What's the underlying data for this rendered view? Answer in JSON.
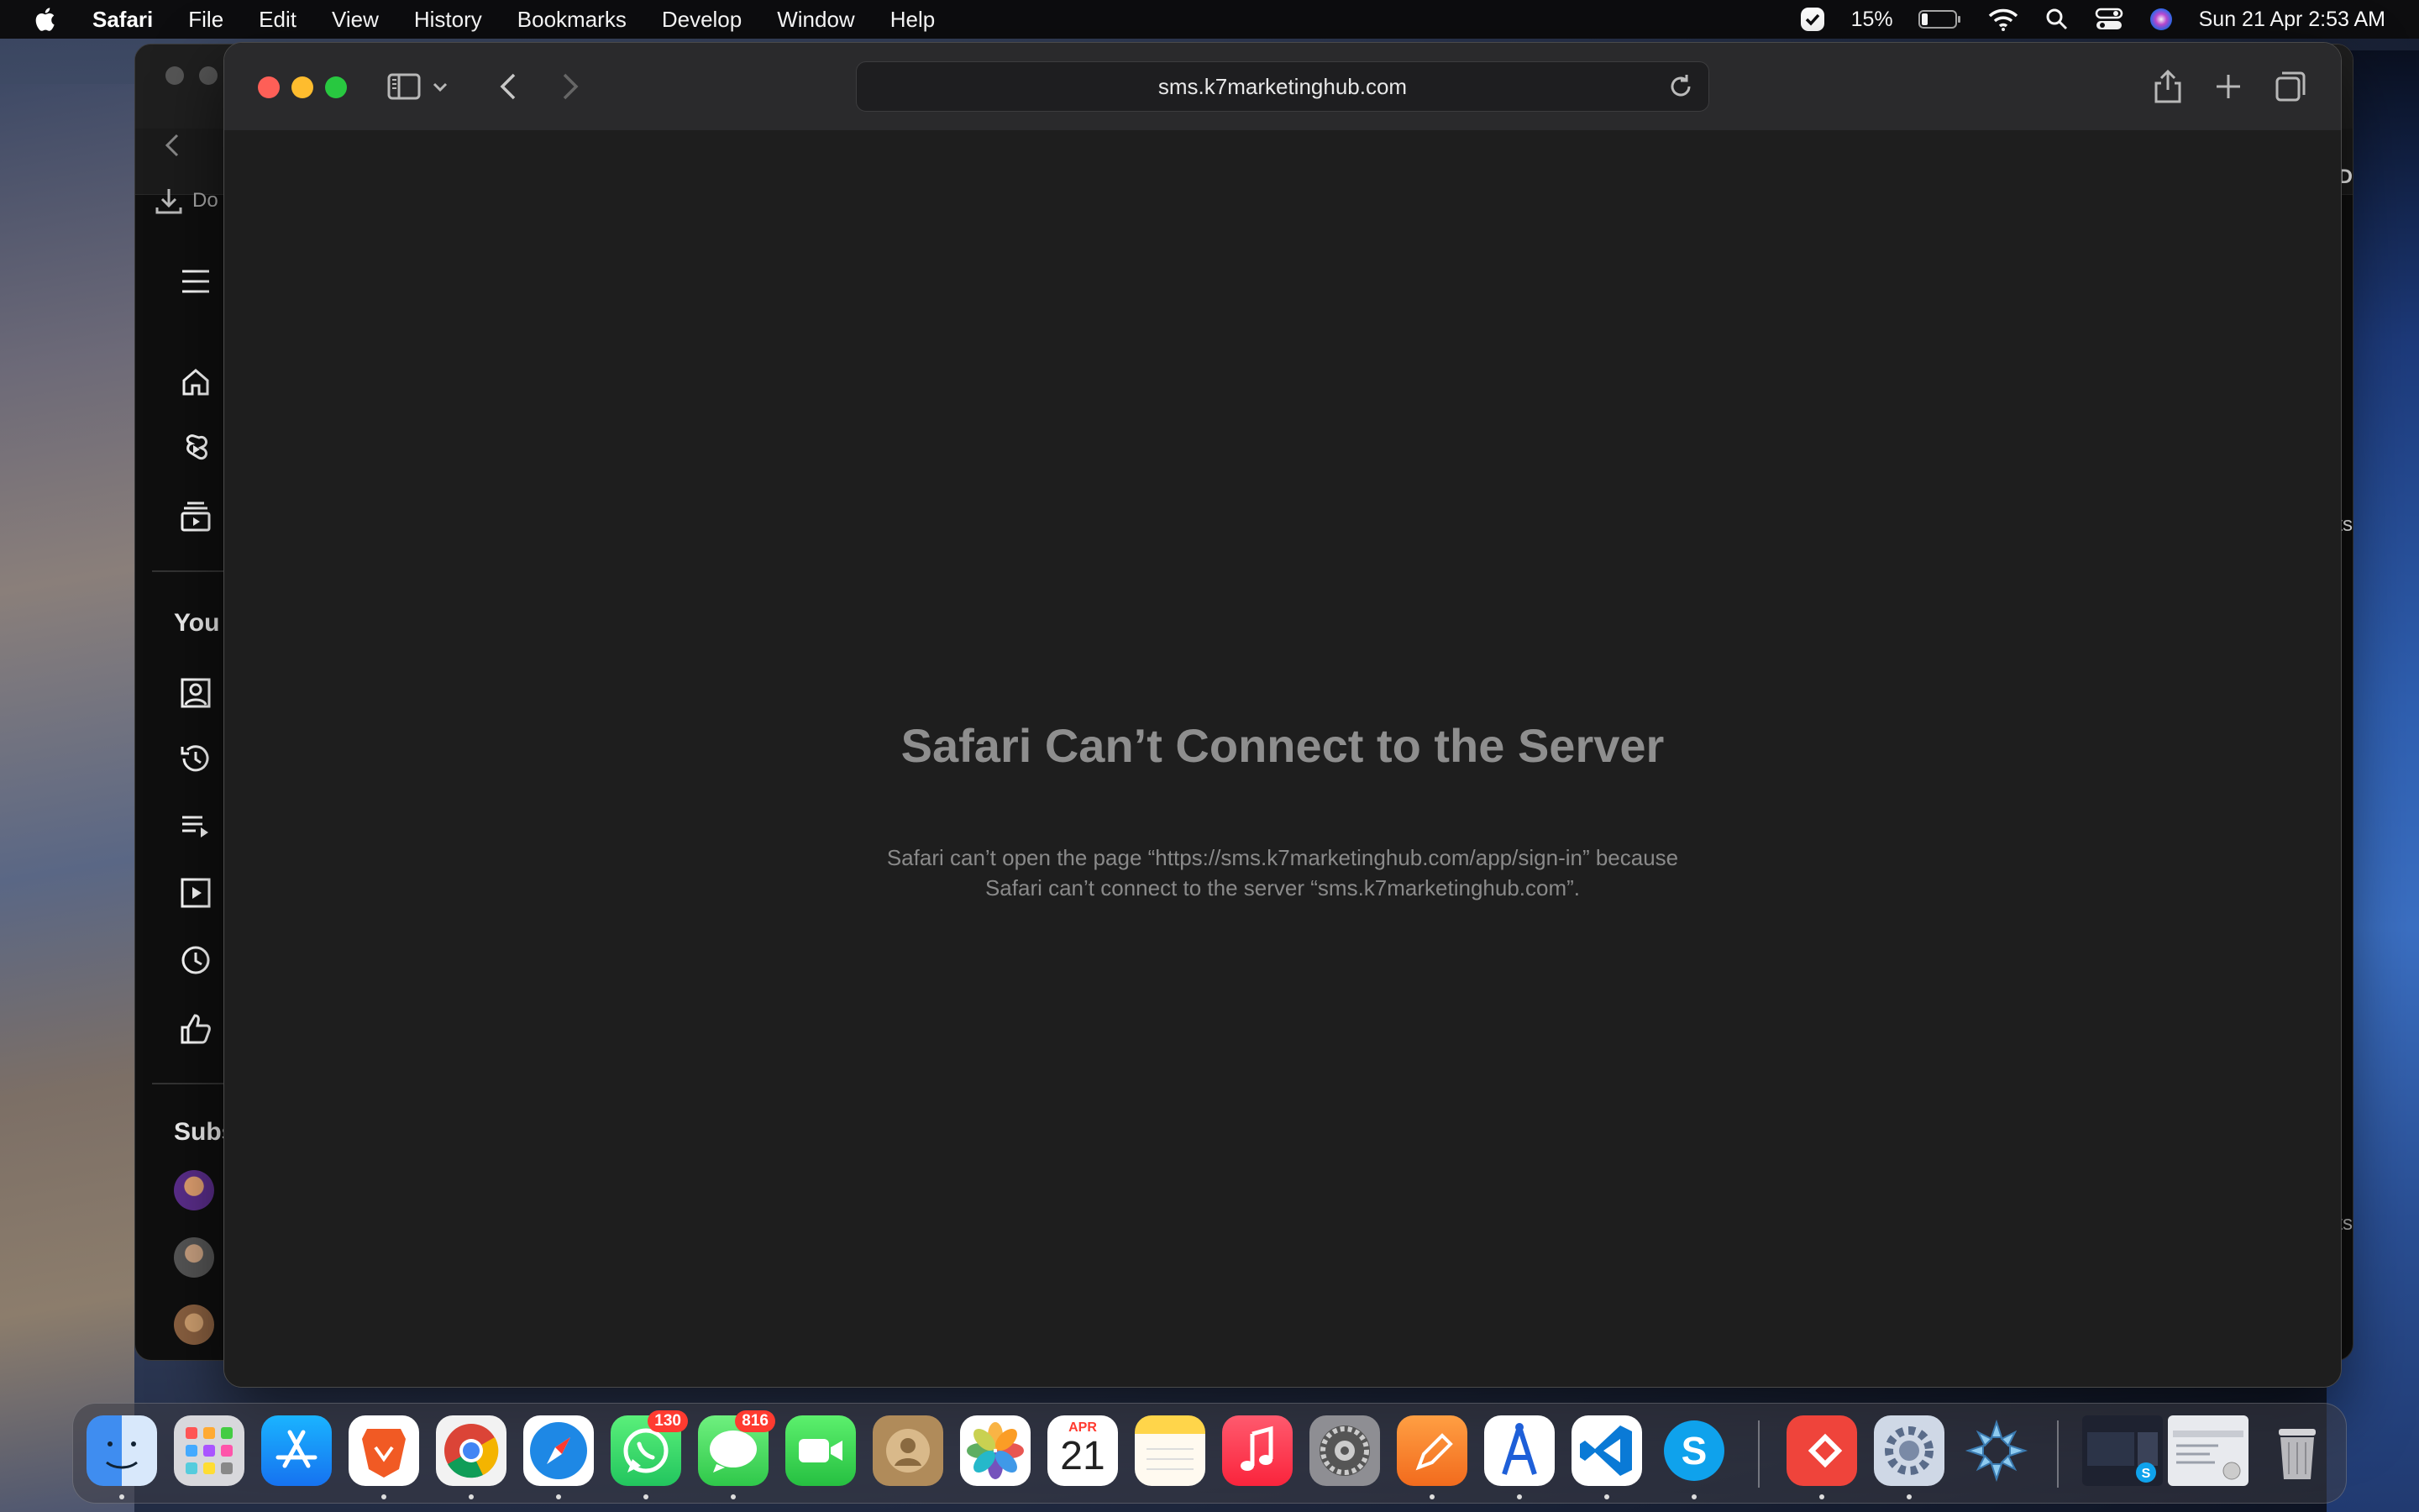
{
  "menubar": {
    "app_name": "Safari",
    "menus": [
      "File",
      "Edit",
      "View",
      "History",
      "Bookmarks",
      "Develop",
      "Window",
      "Help"
    ],
    "battery": "15%",
    "datetime": "Sun 21 Apr  2:53 AM"
  },
  "background_window": {
    "download_label": "Do",
    "section_you": "You",
    "section_subs": "Subs",
    "right_labels": [
      "HD",
      "ents",
      "ts"
    ]
  },
  "safari": {
    "url": "sms.k7marketinghub.com",
    "error_title": "Safari Can’t Connect to the Server",
    "error_line1": "Safari can’t open the page “https://sms.k7marketinghub.com/app/sign-in” because",
    "error_line2": "Safari can’t connect to the server “sms.k7marketinghub.com”."
  },
  "dock": {
    "whatsapp_badge": "130",
    "messages_badge": "816",
    "calendar_month": "APR",
    "calendar_day": "21"
  }
}
